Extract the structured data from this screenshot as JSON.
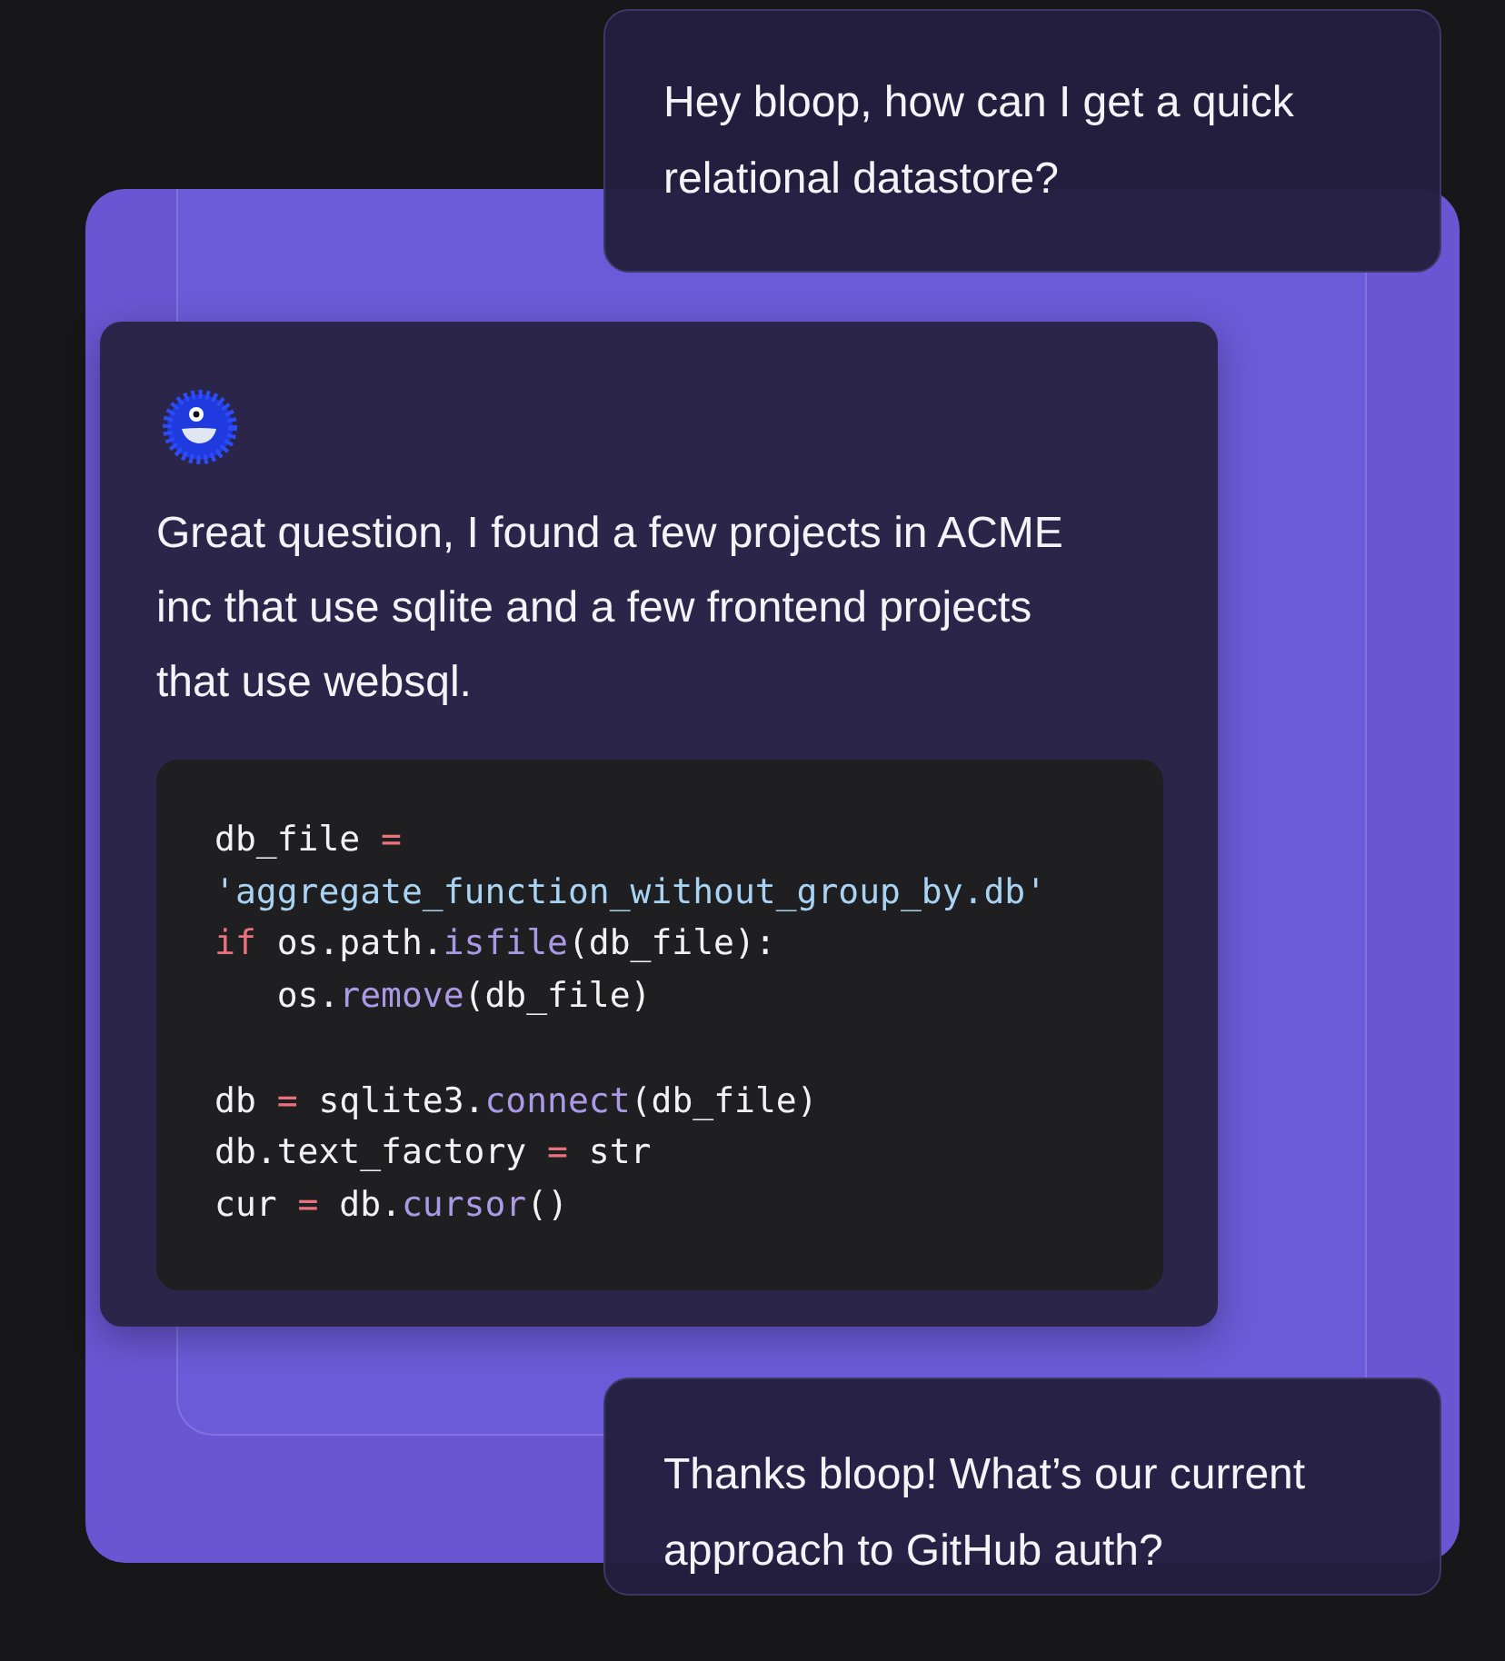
{
  "messages": [
    {
      "kind": "user",
      "text": "Hey bloop, how can I get a quick relational datastore?"
    },
    {
      "kind": "bot",
      "text": "Great question, I found a few projects in ACME inc that use sqlite and a few frontend projects that use websql.",
      "code": [
        {
          "kind": "code",
          "tokens": [
            {
              "kind": "plain",
              "text": "db_file "
            },
            {
              "kind": "op",
              "text": "="
            }
          ]
        },
        {
          "kind": "code",
          "tokens": [
            {
              "kind": "string",
              "text": "'aggregate_function_without_group_by.db'"
            }
          ]
        },
        {
          "kind": "code",
          "tokens": [
            {
              "kind": "keyword",
              "text": "if"
            },
            {
              "kind": "plain",
              "text": " os.path."
            },
            {
              "kind": "func",
              "text": "isfile"
            },
            {
              "kind": "plain",
              "text": "(db_file):"
            }
          ]
        },
        {
          "kind": "code",
          "tokens": [
            {
              "kind": "plain",
              "text": "   os."
            },
            {
              "kind": "func",
              "text": "remove"
            },
            {
              "kind": "plain",
              "text": "(db_file)"
            }
          ]
        },
        {
          "kind": "blank"
        },
        {
          "kind": "code",
          "tokens": [
            {
              "kind": "plain",
              "text": "db "
            },
            {
              "kind": "op",
              "text": "="
            },
            {
              "kind": "plain",
              "text": " sqlite3."
            },
            {
              "kind": "func",
              "text": "connect"
            },
            {
              "kind": "plain",
              "text": "(db_file)"
            }
          ]
        },
        {
          "kind": "code",
          "tokens": [
            {
              "kind": "plain",
              "text": "db.text_factory "
            },
            {
              "kind": "op",
              "text": "="
            },
            {
              "kind": "plain",
              "text": " str"
            }
          ]
        },
        {
          "kind": "code",
          "tokens": [
            {
              "kind": "plain",
              "text": "cur "
            },
            {
              "kind": "op",
              "text": "="
            },
            {
              "kind": "plain",
              "text": " db."
            },
            {
              "kind": "func",
              "text": "cursor"
            },
            {
              "kind": "plain",
              "text": "()"
            }
          ]
        }
      ]
    },
    {
      "kind": "user",
      "text": "Thanks bloop! What’s our current approach to GitHub auth?"
    }
  ]
}
